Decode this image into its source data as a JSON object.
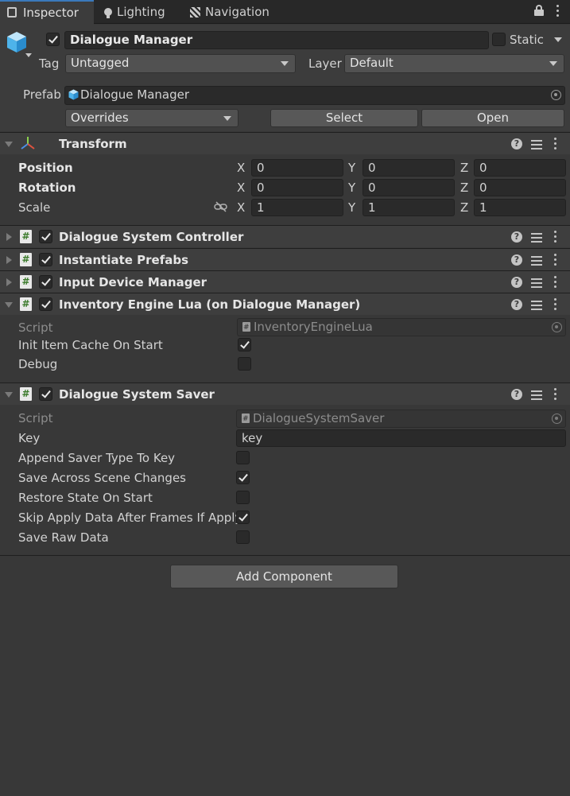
{
  "tabs": [
    {
      "label": "Inspector",
      "active": true
    },
    {
      "label": "Lighting",
      "active": false
    },
    {
      "label": "Navigation",
      "active": false
    }
  ],
  "object": {
    "name": "Dialogue Manager",
    "active": true,
    "static_label": "Static",
    "static": false,
    "tag_label": "Tag",
    "tag_value": "Untagged",
    "layer_label": "Layer",
    "layer_value": "Default"
  },
  "prefab": {
    "label": "Prefab",
    "asset": "Dialogue Manager",
    "overrides": "Overrides",
    "select": "Select",
    "open": "Open"
  },
  "transform": {
    "title": "Transform",
    "position_label": "Position",
    "rotation_label": "Rotation",
    "scale_label": "Scale",
    "axis_x": "X",
    "axis_y": "Y",
    "axis_z": "Z",
    "position": {
      "x": "0",
      "y": "0",
      "z": "0"
    },
    "rotation": {
      "x": "0",
      "y": "0",
      "z": "0"
    },
    "scale": {
      "x": "1",
      "y": "1",
      "z": "1"
    }
  },
  "collapsed_components": [
    {
      "title": "Dialogue System Controller",
      "enabled": true
    },
    {
      "title": "Instantiate Prefabs",
      "enabled": true
    },
    {
      "title": "Input Device Manager",
      "enabled": true
    }
  ],
  "inventory_lua": {
    "title": "Inventory Engine Lua (on Dialogue Manager)",
    "enabled": true,
    "script_label": "Script",
    "script_value": "InventoryEngineLua",
    "init_cache_label": "Init Item Cache On Start",
    "init_cache": true,
    "debug_label": "Debug",
    "debug": false
  },
  "saver": {
    "title": "Dialogue System Saver",
    "enabled": true,
    "script_label": "Script",
    "script_value": "DialogueSystemSaver",
    "key_label": "Key",
    "key_value": "key",
    "append_label": "Append Saver Type To Key",
    "append": false,
    "save_across_label": "Save Across Scene Changes",
    "save_across": true,
    "restore_label": "Restore State On Start",
    "restore": false,
    "skip_label": "Skip Apply Data After Frames If Apply",
    "skip": true,
    "raw_label": "Save Raw Data",
    "raw": false
  },
  "add_component": "Add Component"
}
